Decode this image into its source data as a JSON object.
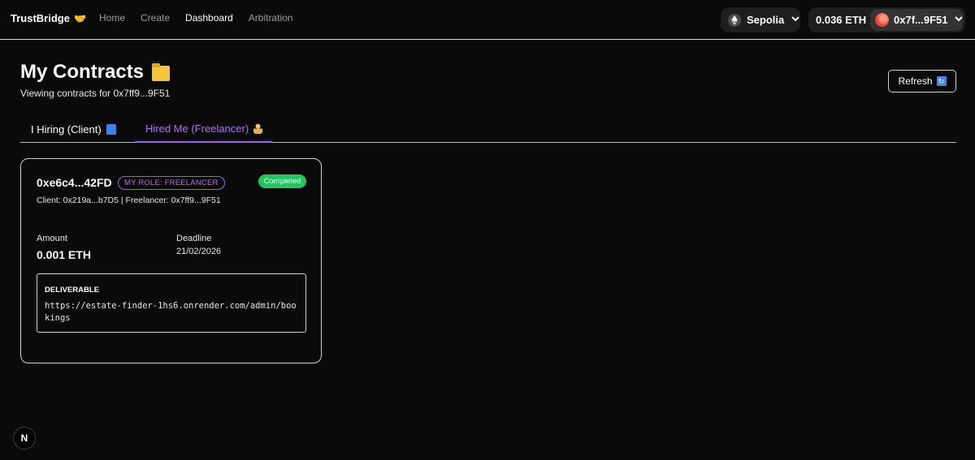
{
  "nav": {
    "brand": "TrustBridge",
    "brand_emoji": "🤝",
    "links": [
      "Home",
      "Create",
      "Dashboard",
      "Arbitration"
    ],
    "active_link": "Dashboard",
    "network": "Sepolia",
    "balance": "0.036 ETH",
    "account": "0x7f...9F51"
  },
  "header": {
    "title": "My Contracts",
    "subtitle": "Viewing contracts for 0x7ff9...9F51",
    "refresh_label": "Refresh"
  },
  "tabs": [
    {
      "label": "I Hiring (Client)",
      "active": false
    },
    {
      "label": "Hired Me (Freelancer)",
      "active": true
    }
  ],
  "contract": {
    "id": "0xe6c4...42FD",
    "role": "MY ROLE: FREELANCER",
    "status": "Completed",
    "parties": "Client: 0x219a...b7D5 | Freelancer: 0x7ff9...9F51",
    "amount_label": "Amount",
    "amount": "0.001 ETH",
    "deadline_label": "Deadline",
    "deadline": "21/02/2026",
    "deliverable_label": "DELIVERABLE",
    "deliverable": "https://estate-finder-1hs6.onrender.com/admin/bookings"
  },
  "next_indicator": "N",
  "colors": {
    "background": "#0a0a0a",
    "accent_purple": "#a855f7",
    "status_green": "#22c55e"
  }
}
